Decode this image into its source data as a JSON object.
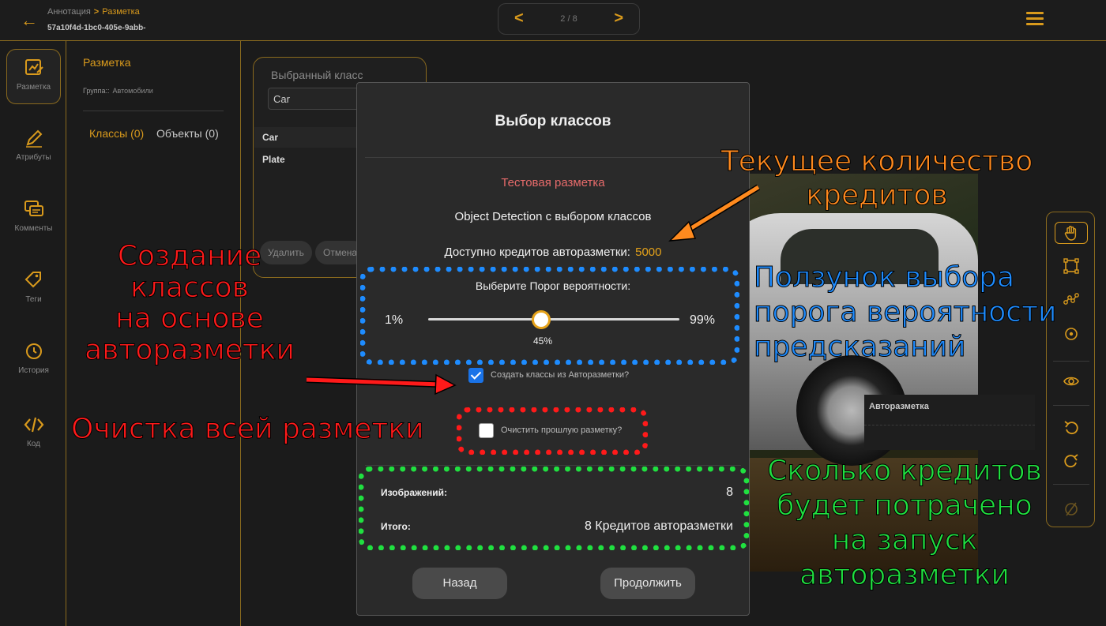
{
  "header": {
    "breadcrumb_root": "Аннотация",
    "breadcrumb_sep": ">",
    "breadcrumb_current": "Разметка",
    "doc_id": "57a10f4d-1bc0-405e-9abb-",
    "pager": {
      "prev": "<",
      "page": "2 / 8",
      "next": ">"
    }
  },
  "sidebar": {
    "items": [
      {
        "label": "Разметка",
        "icon": "markup-icon"
      },
      {
        "label": "Атрибуты",
        "icon": "pen-icon"
      },
      {
        "label": "Комменты",
        "icon": "comments-icon"
      },
      {
        "label": "Теги",
        "icon": "tag-icon"
      },
      {
        "label": "История",
        "icon": "history-icon"
      },
      {
        "label": "Код",
        "icon": "code-icon"
      }
    ]
  },
  "panel": {
    "title": "Разметка",
    "group_label": "Группа::",
    "group_value": "Автомобили",
    "tab_classes": "Классы (0)",
    "tab_objects": "Объекты (0)"
  },
  "class_card": {
    "label": "Выбранный класс",
    "selected": "Car",
    "rows": [
      "Car",
      "Plate"
    ],
    "delete_btn": "Удалить",
    "cancel_btn": "Отмена"
  },
  "autopanel": {
    "title": "Авторазметка"
  },
  "modal": {
    "title": "Выбор классов",
    "subtitle": "Тестовая разметка",
    "task_type": "Object Detection с выбором классов",
    "credits_label": "Доступно кредитов авторазметки:",
    "credits_value": "5000",
    "threshold_label": "Выберите Порог вероятности:",
    "threshold_min": "1%",
    "threshold_max": "99%",
    "threshold_value_text": "45%",
    "threshold_percent": 45,
    "create_classes_label": "Создать классы из Авторазметки?",
    "create_classes_checked": true,
    "clear_label": "Очистить прошлую разметку?",
    "clear_checked": false,
    "images_label": "Изображений:",
    "images_value": "8",
    "total_label": "Итого:",
    "total_value": "8 Кредитов авторазметки",
    "back_btn": "Назад",
    "continue_btn": "Продолжить"
  },
  "annotations": {
    "credits": [
      "Текущее количество",
      "кредитов"
    ],
    "create": [
      "Создание",
      "классов",
      "на основе",
      "авторазметки"
    ],
    "slider": [
      "Ползунок выбора",
      "порога вероятности",
      "предсказаний"
    ],
    "clear": "Очистка всей разметки",
    "spend": [
      "Сколько кредитов",
      "будет потрачено",
      "на запуск",
      "авторазметки"
    ]
  },
  "colors": {
    "accent": "#d99a1c",
    "checkbox_blue": "#1a73e8",
    "annotation_orange": "#ff8a1e",
    "annotation_red": "#ff1a1a",
    "annotation_blue": "#1e8cff",
    "annotation_green": "#20e040"
  }
}
